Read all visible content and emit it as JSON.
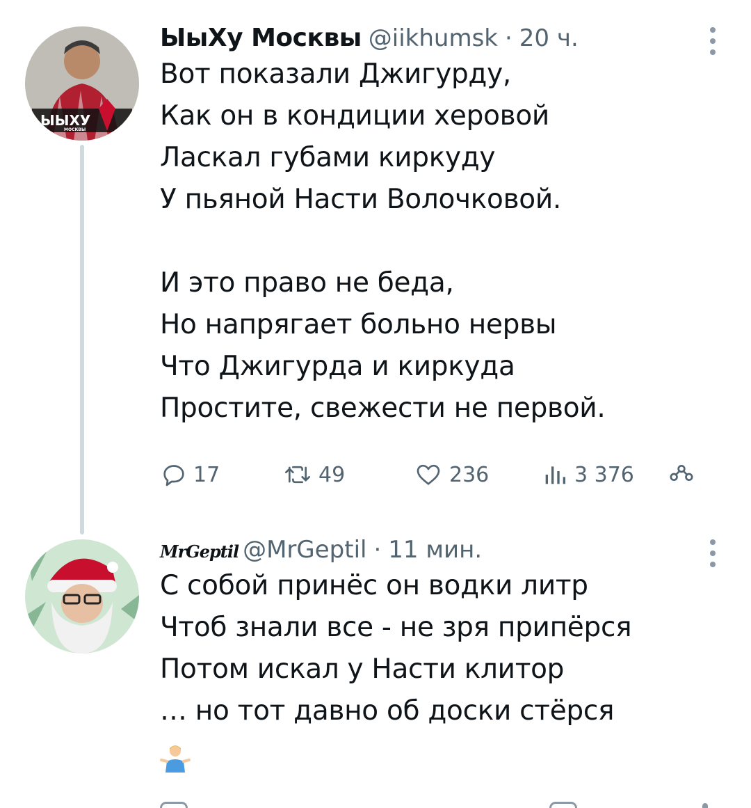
{
  "tweet1": {
    "display_name": "ЫыХу Москвы",
    "handle": "@iikhumsk",
    "separator": "·",
    "time": "20 ч.",
    "avatar_label": "ЫЫХУ",
    "avatar_sublabel": "МОСКВЫ",
    "lines": [
      "Вот показали Джигурду,",
      "Как он в кондиции херовой",
      "Ласкал губами киркуду",
      "У пьяной Насти Волочковой.",
      "",
      "И это право не беда,",
      "Но напрягает больно нервы",
      "Что Джигурда и киркуда",
      "Простите, свежести не первой."
    ],
    "actions": {
      "replies": "17",
      "retweets": "49",
      "likes": "236",
      "views": "3 376"
    }
  },
  "tweet2": {
    "display_name": "MrGeptil",
    "handle": "@MrGeptil",
    "separator": "·",
    "time": "11 мин.",
    "lines": [
      "С собой принёс он водки литр",
      "Чтоб знали все - не зря припёрся",
      "Потом искал у Насти клитор",
      "… но тот давно об доски стёрся"
    ],
    "emoji": "person-shrugging"
  },
  "colors": {
    "text": "#0f1419",
    "secondary": "#536471",
    "thread_line": "#cfd9de",
    "avatar1_bg": "#1c1c1c",
    "avatar1_accent": "#c8102e",
    "avatar2_bg": "#cfe6d2"
  }
}
